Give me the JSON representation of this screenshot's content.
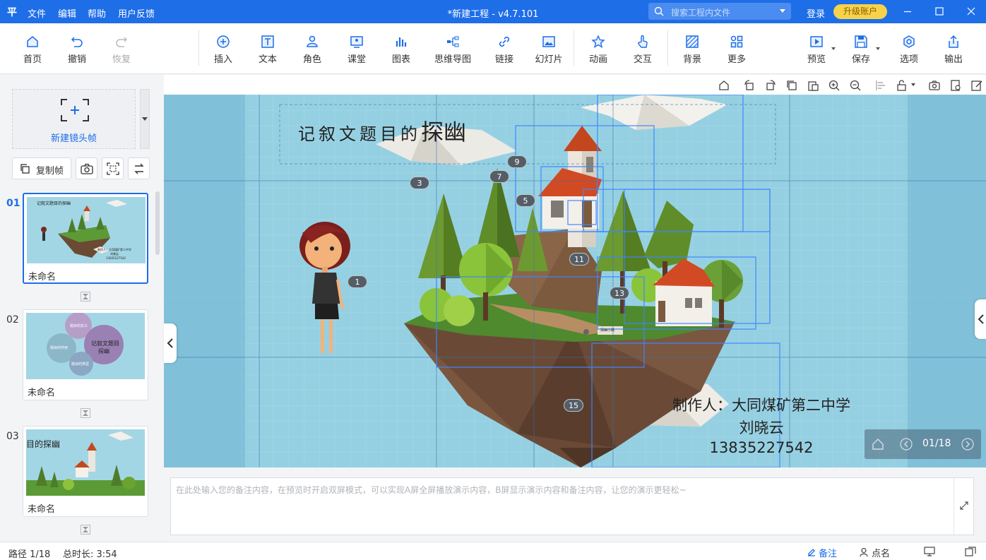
{
  "titlebar": {
    "logo": "平",
    "menus": [
      "文件",
      "编辑",
      "帮助",
      "用户反馈"
    ],
    "window_title": "*新建工程 - v4.7.101",
    "search_placeholder": "搜索工程内文件",
    "login": "登录",
    "upgrade": "升级账户",
    "accent": "#1e6ee8"
  },
  "toolbar": {
    "home": "首页",
    "undo": "撤销",
    "redo": "恢复",
    "insert": "插入",
    "text": "文本",
    "role": "角色",
    "classroom": "课堂",
    "chart": "图表",
    "mindmap": "思维导图",
    "link": "链接",
    "slides": "幻灯片",
    "animation": "动画",
    "interaction": "交互",
    "background": "背景",
    "more": "更多",
    "preview": "预览",
    "save": "保存",
    "options": "选项",
    "export": "输出"
  },
  "left": {
    "new_frame": "新建镜头帧",
    "copy_frame": "复制帧",
    "frames": [
      {
        "num": "01",
        "name": "未命名"
      },
      {
        "num": "02",
        "name": "未命名"
      },
      {
        "num": "03",
        "name": "未命名"
      }
    ],
    "thumb1": {
      "title": "记叙文题目的探幽",
      "t1": "制作人：大同煤矿第二中学",
      "t2": "刘晓云",
      "t3": "13835227542"
    },
    "thumb2": {
      "center": "记叙文题目",
      "center2": "探幽",
      "b1": "题目的定义",
      "b2": "题目的作用",
      "b3": "题目的类型"
    },
    "thumb3": {
      "title": "目的探幽"
    }
  },
  "slide": {
    "title": "记叙文题目的探幽",
    "author_line": "制作人：大同煤矿第二中学",
    "author_name": "刘晓云",
    "phone": "13835227542",
    "small_sign": "探幽小路",
    "markers": [
      "1",
      "3",
      "5",
      "7",
      "9",
      "11",
      "13",
      "15"
    ]
  },
  "pager": {
    "count": "01/18"
  },
  "notes": {
    "placeholder": "在此处输入您的备注内容，在预览时开启双屏模式，可以实现A屏全屏播放演示内容，B屏显示演示内容和备注内容，让您的演示更轻松~"
  },
  "status": {
    "path": "路径 1/18",
    "duration": "总时长: 3:54",
    "notes": "备注",
    "rollcall": "点名"
  }
}
